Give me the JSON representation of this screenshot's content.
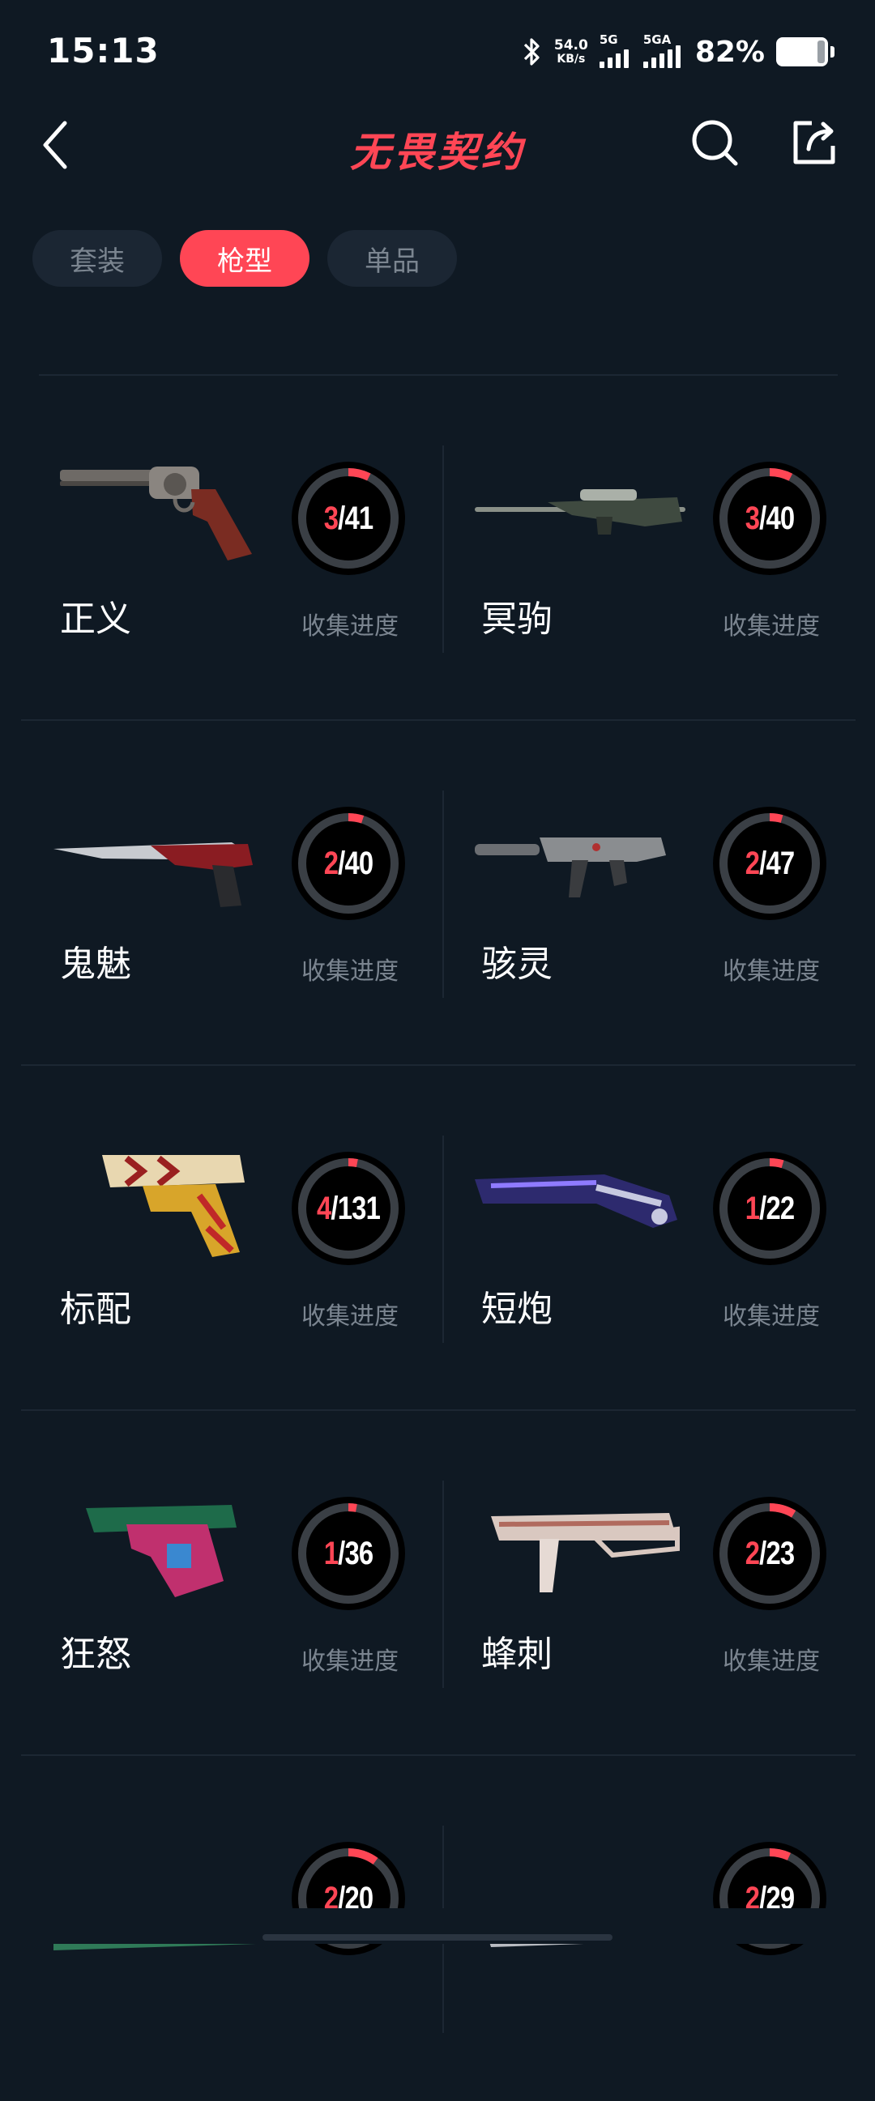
{
  "status": {
    "time": "15:13",
    "net_speed_value": "54.0",
    "net_speed_unit": "KB/s",
    "sim1_tag": "5G",
    "sim2_tag": "5GA",
    "battery_percent": "82%",
    "battery_level": 0.82
  },
  "header": {
    "title": "无畏契约",
    "back_icon": "chevron-left-icon",
    "search_icon": "search-icon",
    "share_icon": "share-icon"
  },
  "tabs": [
    {
      "label": "套装",
      "active": false
    },
    {
      "label": "枪型",
      "active": true
    },
    {
      "label": "单品",
      "active": false
    }
  ],
  "progress_label": "收集进度",
  "colors": {
    "background": "#0f1923",
    "accent": "#ff4655",
    "ring_track": "#3a3f45",
    "muted_text": "#7b8590"
  },
  "weapons": [
    {
      "name": "正义",
      "collected": "3",
      "total": "41"
    },
    {
      "name": "冥驹",
      "collected": "3",
      "total": "40"
    },
    {
      "name": "鬼魅",
      "collected": "2",
      "total": "40"
    },
    {
      "name": "骇灵",
      "collected": "2",
      "total": "47"
    },
    {
      "name": "标配",
      "collected": "4",
      "total": "131"
    },
    {
      "name": "短炮",
      "collected": "1",
      "total": "22"
    },
    {
      "name": "狂怒",
      "collected": "1",
      "total": "36"
    },
    {
      "name": "蜂刺",
      "collected": "2",
      "total": "23"
    },
    {
      "name": "",
      "collected": "2",
      "total": "20"
    },
    {
      "name": "",
      "collected": "2",
      "total": "29"
    }
  ]
}
